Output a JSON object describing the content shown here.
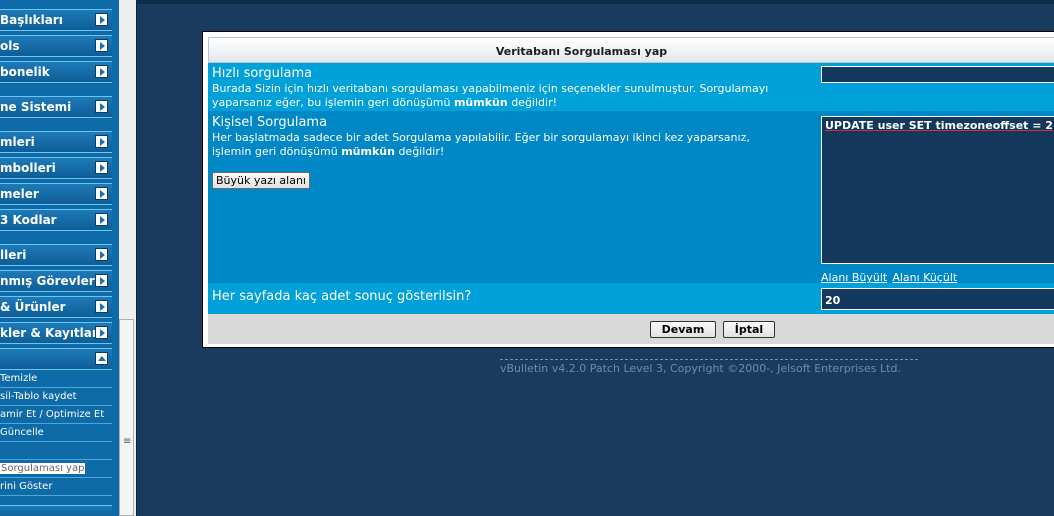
{
  "nav": {
    "groups": [
      {
        "label": "Başlıkları"
      },
      {
        "label": "ols"
      },
      {
        "label": "bonelik"
      },
      {
        "label": "ne Sistemi"
      },
      {
        "label": "mleri"
      },
      {
        "label": "mbolleri"
      },
      {
        "label": "meler"
      },
      {
        "label": "3 Kodlar"
      },
      {
        "label": "lleri"
      },
      {
        "label": "nmış Görevler"
      },
      {
        "label": "& Ürünler"
      },
      {
        "label": "kler & Kayıtlar"
      }
    ],
    "items": [
      {
        "label": "Temizle"
      },
      {
        "label": "sil-Tablo kaydet"
      },
      {
        "label": "amir Et / Optimize Et"
      },
      {
        "label": "Güncelle"
      },
      {
        "label": ""
      },
      {
        "label": "Sorgulaması yap"
      },
      {
        "label": "rini Göster"
      }
    ],
    "splitter_grip": "≡"
  },
  "panel": {
    "title": "Veritabanı Sorgulaması yap",
    "quick": {
      "title": "Hızlı sorgulama",
      "desc_main": "Burada Sizin için hızlı veritabanı sorgulaması yapabilmeniz için seçenekler sunulmuştur. Sorgulamayı yaparsanız eğer, bu işlemin geri dönüşümü ",
      "desc_bold": "mümkün",
      "desc_end": " değildir!",
      "select_value": ""
    },
    "custom": {
      "title": "Kişisel Sorgulama",
      "desc_main": "Her başlatmada sadece bir adet Sorgulama yapılabilir. Eğer bir sorgulamayı ikinci kez yaparsanız, işlemin geri dönüşümü ",
      "desc_bold": "mümkün",
      "desc_end": " değildir!",
      "big_button": "Büyük yazı alanı",
      "query": "UPDATE user SET timezoneoffset = 2",
      "enlarge": "Alanı Büyült",
      "shrink": "Alanı Küçült"
    },
    "per_page": {
      "label": "Her sayfada kaç adet sonuç gösterilsin?",
      "value": "20"
    },
    "buttons": {
      "submit": "Devam",
      "cancel": "İptal"
    }
  },
  "footer": {
    "copyright": "vBulletin v4.2.0 Patch Level 3, Copyright ©2000-, Jelsoft Enterprises Ltd."
  },
  "colors": {
    "page_bg": "#1b3b5e",
    "row_light": "#00a0d8",
    "row_dark": "#0087c6",
    "field_bg": "#13375d"
  }
}
